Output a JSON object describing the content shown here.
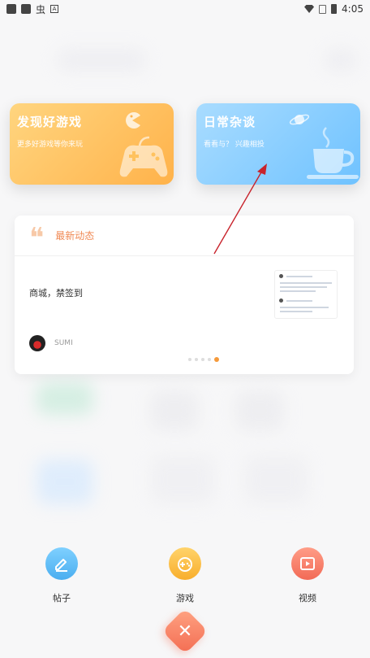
{
  "status_bar": {
    "time": "4:05",
    "bug_icon": "虫",
    "a_icon": "A"
  },
  "cards": [
    {
      "title": "发现好游戏",
      "subtitle": "更多好游戏等你来玩",
      "icon": "gamepad-icon",
      "accent": "#ffb24a"
    },
    {
      "title": "日常杂谈",
      "subtitle": "看看与？ 兴趣相投",
      "icon": "coffee-cup-icon",
      "accent": "#6fc2ff"
    }
  ],
  "news": {
    "header": "最新动态",
    "text": "商城，禁签到",
    "user": "SUMI",
    "pages": 5,
    "active_page": 5
  },
  "actions": [
    {
      "label": "帖子",
      "icon": "edit-icon"
    },
    {
      "label": "游戏",
      "icon": "gamepad-icon"
    },
    {
      "label": "视频",
      "icon": "video-icon"
    }
  ],
  "close": {
    "symbol": "✕",
    "icon": "close-icon"
  },
  "colors": {
    "accent_orange": "#f08a55",
    "blue": "#6fc2ff",
    "red": "#f26a56"
  }
}
